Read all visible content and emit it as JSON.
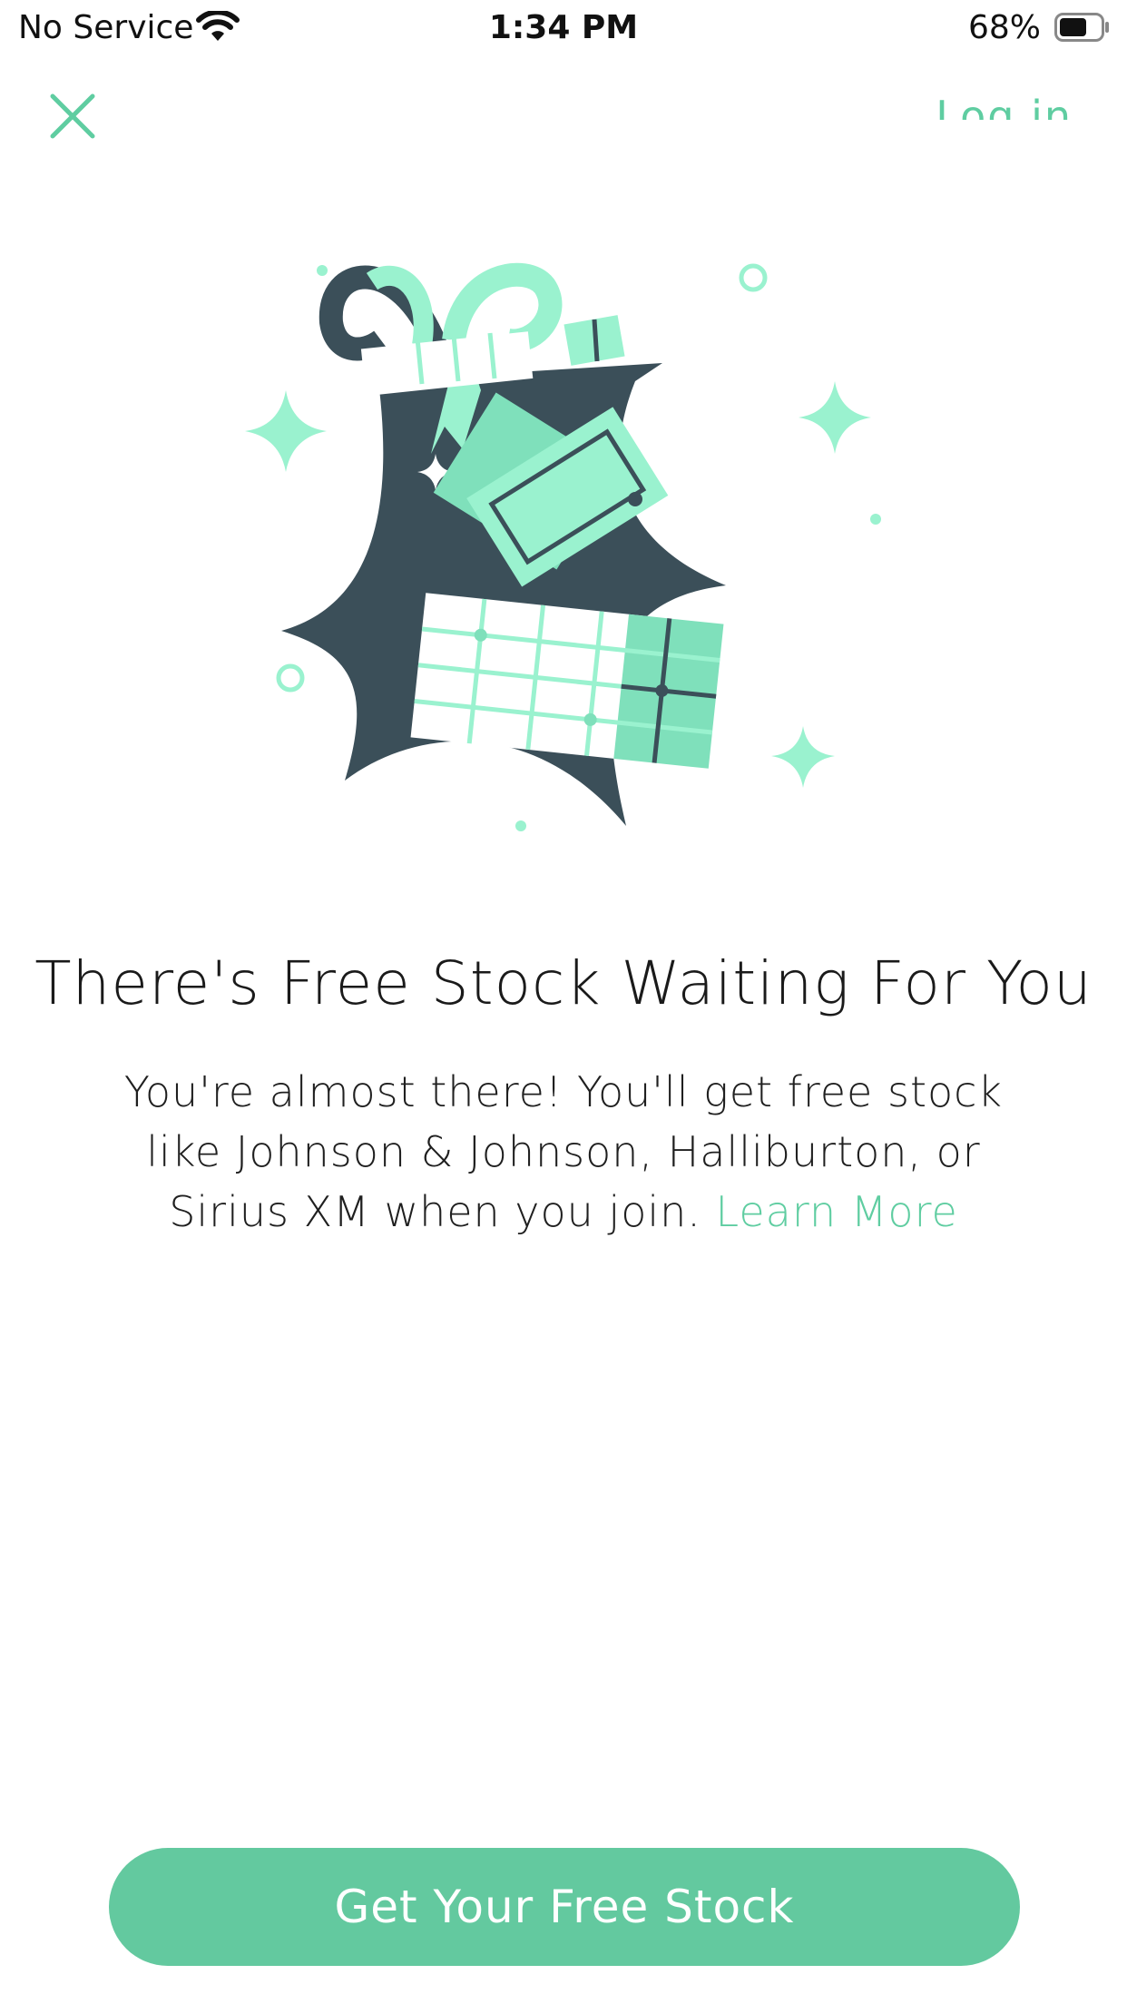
{
  "status_bar": {
    "carrier": "No Service",
    "time": "1:34 PM",
    "battery_percent": "68%",
    "battery_level": 0.68
  },
  "nav": {
    "close_icon": "close-icon",
    "login_label": "Log in"
  },
  "content": {
    "headline": "There's Free Stock Waiting For You",
    "body": "You're almost there! You'll get free stock like Johnson & Johnson, Halliburton, or Sirius XM when you join.",
    "learn_more": "Learn More"
  },
  "cta": {
    "label": "Get Your Free Stock"
  },
  "colors": {
    "accent": "#5fcda1",
    "button": "#63c99f",
    "illustration_dark": "#3b4f59",
    "illustration_light": "#9af2cf"
  }
}
